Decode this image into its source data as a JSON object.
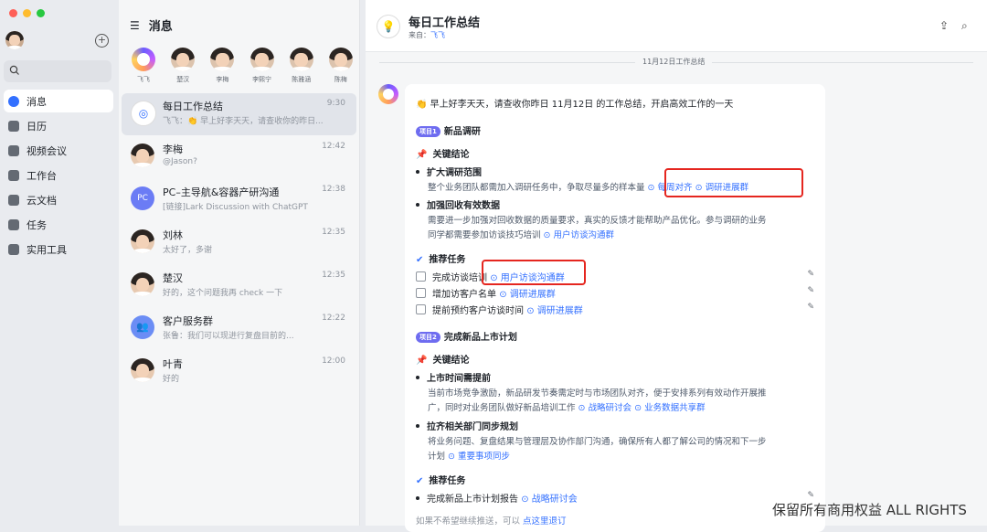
{
  "window": {
    "colors": [
      "#fe5f57",
      "#febc2e",
      "#28c840"
    ]
  },
  "nav": {
    "items": [
      {
        "label": "消息",
        "icon": "message-icon"
      },
      {
        "label": "日历",
        "icon": "calendar-icon"
      },
      {
        "label": "视频会议",
        "icon": "video-icon"
      },
      {
        "label": "工作台",
        "icon": "workspace-icon"
      },
      {
        "label": "云文档",
        "icon": "doc-icon"
      },
      {
        "label": "任务",
        "icon": "task-icon"
      },
      {
        "label": "实用工具",
        "icon": "tools-icon"
      }
    ]
  },
  "list": {
    "title": "消息",
    "pinned": [
      "飞飞",
      "楚汉",
      "李梅",
      "李熙宁",
      "陈雅涵",
      "陈梅"
    ],
    "chats": [
      {
        "name": "每日工作总结",
        "time": "9:30",
        "msg": "飞飞：👏 早上好李天天，请查收你的昨日..."
      },
      {
        "name": "李梅",
        "time": "12:42",
        "msg": "@Jason?"
      },
      {
        "name": "PC–主导航&容器产研沟通",
        "time": "12:38",
        "msg": "[链接]Lark Discussion with ChatGPT",
        "avatar_text": "PC"
      },
      {
        "name": "刘林",
        "time": "12:35",
        "msg": "太好了，多谢"
      },
      {
        "name": "楚汉",
        "time": "12:35",
        "msg": "好的，这个问题我再 check 一下"
      },
      {
        "name": "客户服务群",
        "time": "12:22",
        "msg": "张鲁：我们可以现进行复盘目前的..."
      },
      {
        "name": "叶青",
        "time": "12:00",
        "msg": "好的"
      }
    ]
  },
  "main": {
    "title": "每日工作总结",
    "from_label": "来自：",
    "from_name": "飞飞",
    "date_divider": "11月12日工作总结",
    "greeting": "👏 早上好李天天，请查收你昨日 11月12日 的工作总结，开启高效工作的一天",
    "p1": {
      "tag": "项目1",
      "title": "新品调研",
      "conclusion_label": "关键结论",
      "b1_title": "扩大调研范围",
      "b1_text": "整个业务团队都需加入调研任务中，争取尽量多的样本量",
      "b1_link1": "每周对齐",
      "b1_link2": "调研进展群",
      "b2_title": "加强回收有效数据",
      "b2_text1": "需要进一步加强对回收数据的质量要求，真实的反馈才能帮助产品优化。参与调研的业务",
      "b2_text2": "同学都需要参加访谈技巧培训",
      "b2_link": "用户访谈沟通群",
      "task_label": "推荐任务",
      "t1": "完成访谈培训",
      "t1_link": "用户访谈沟通群",
      "t2": "增加访客户名单",
      "t2_link": "调研进展群",
      "t3": "提前预约客户访谈时间",
      "t3_link": "调研进展群"
    },
    "p2": {
      "tag": "项目2",
      "title": "完成新品上市计划",
      "conclusion_label": "关键结论",
      "b1_title": "上市时间需提前",
      "b1_text1": "当前市场竞争激励，新品研发节奏需定时与市场团队对齐，便于安排系列有效动作开展推",
      "b1_text2": "广，同时对业务团队做好新品培训工作",
      "b1_link1": "战略研讨会",
      "b1_link2": "业务数据共享群",
      "b2_title": "拉齐相关部门同步规划",
      "b2_text1": "将业务问题、复盘结果与管理层及协作部门沟通，确保所有人都了解公司的情况和下一步",
      "b2_text2": "计划",
      "b2_link": "重要事项同步",
      "task_label": "推荐任务",
      "t1": "完成新品上市计划报告",
      "t1_link": "战略研讨会"
    },
    "footer_text": "如果不希望继续推送，可以",
    "footer_link": "点这里退订"
  },
  "watermark": "保留所有商用权益  ALL RIGHTS"
}
